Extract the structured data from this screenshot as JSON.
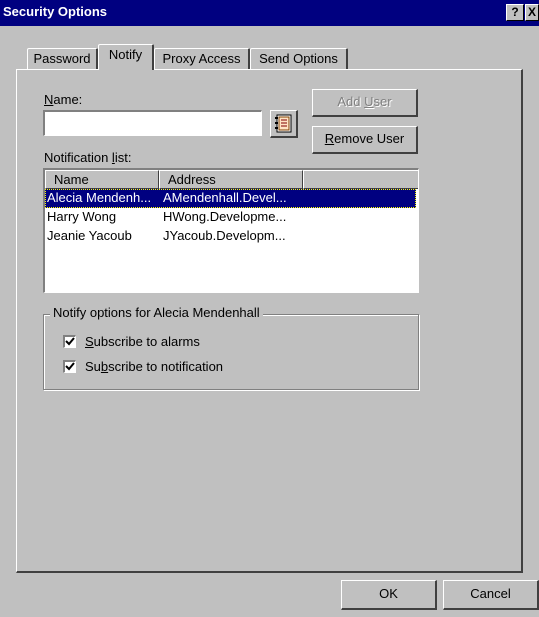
{
  "window": {
    "title": "Security Options",
    "help_glyph": "?",
    "close_glyph": "X"
  },
  "tabs": [
    {
      "label": "Password",
      "active": false
    },
    {
      "label": "Notify",
      "active": true
    },
    {
      "label": "Proxy Access",
      "active": false
    },
    {
      "label": "Send Options",
      "active": false
    }
  ],
  "notify": {
    "name_label_prefix": "",
    "name_label_hotkey": "N",
    "name_label_rest": "ame:",
    "name_value": "",
    "address_book_icon": "address-book-icon",
    "add_user": {
      "prefix": "Add ",
      "hotkey": "U",
      "rest": "ser",
      "enabled": false
    },
    "remove_user": {
      "prefix": "",
      "hotkey": "R",
      "rest": "emove User",
      "enabled": true
    },
    "list_label_prefix": "Notification ",
    "list_label_hotkey": "l",
    "list_label_rest": "ist:",
    "columns": [
      "Name",
      "Address"
    ],
    "rows": [
      {
        "name": "Alecia Mendenh...",
        "address": "AMendenhall.Devel...",
        "selected": true
      },
      {
        "name": "Harry Wong",
        "address": "HWong.Developme...",
        "selected": false
      },
      {
        "name": "Jeanie Yacoub",
        "address": "JYacoub.Developm...",
        "selected": false
      }
    ],
    "options_group_label": "Notify options for Alecia Mendenhall",
    "alarms": {
      "prefix": "",
      "hotkey": "S",
      "rest": "ubscribe to alarms",
      "checked": true
    },
    "notification": {
      "prefix": "Su",
      "hotkey": "b",
      "rest": "scribe to notification",
      "checked": true
    }
  },
  "footer": {
    "ok": "OK",
    "cancel": "Cancel"
  }
}
